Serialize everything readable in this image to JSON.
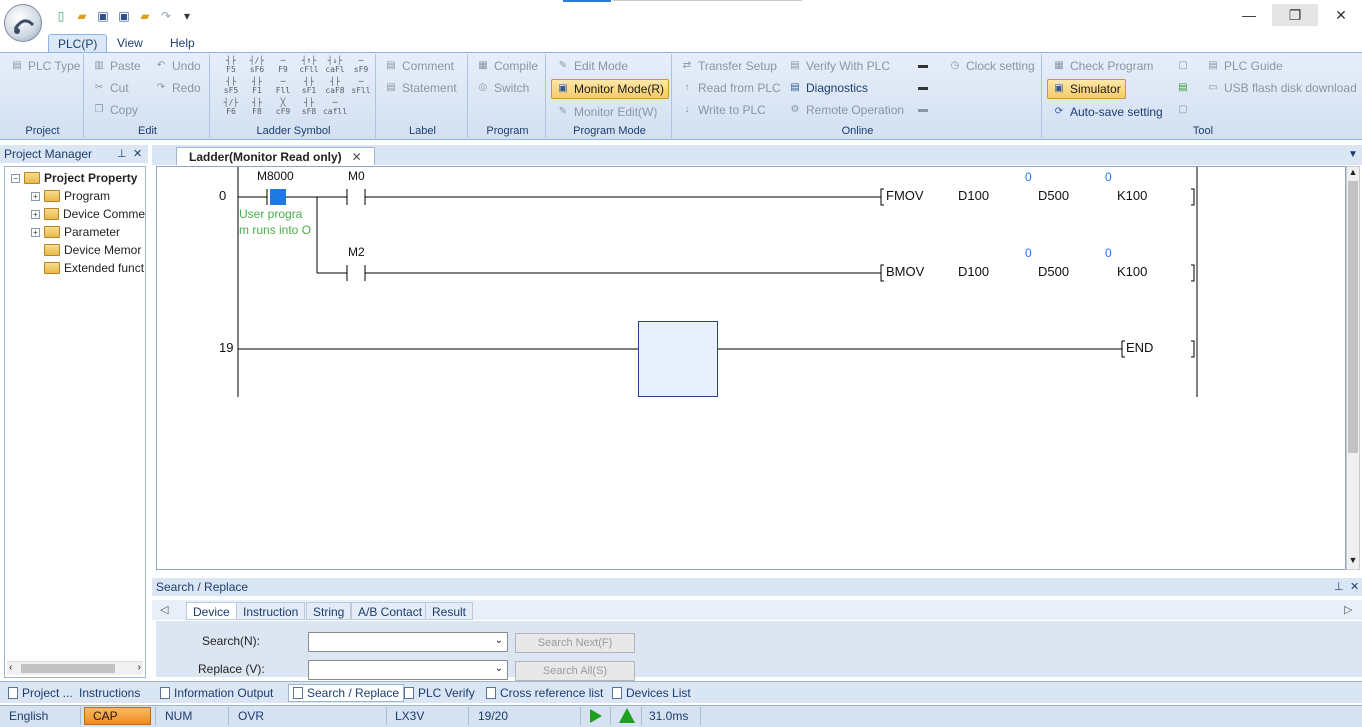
{
  "app": {
    "quick_access_dropdown": "▾"
  },
  "window_controls": {
    "minimize": "—",
    "restore": "❐",
    "close": "✕"
  },
  "ribbon_tabs": [
    "PLC(P)",
    "View",
    "Help"
  ],
  "ribbon": {
    "project": {
      "label": "Project",
      "plc_type": "PLC Type"
    },
    "edit": {
      "label": "Edit",
      "paste": "Paste",
      "cut": "Cut",
      "copy": "Copy",
      "undo": "Undo",
      "redo": "Redo"
    },
    "ladder_symbol": {
      "label": "Ladder Symbol",
      "symbols": [
        [
          "┤├",
          "F5"
        ],
        [
          "┤/├",
          "sF6"
        ],
        [
          "─",
          "F9"
        ],
        [
          "┤↑├",
          "cFll"
        ],
        [
          "┤↓├",
          "caFl"
        ],
        [
          "─",
          "sF9"
        ],
        [
          "┤├",
          "sF5"
        ],
        [
          "┤├",
          "F1"
        ],
        [
          "─",
          "Fll"
        ],
        [
          "┤├",
          "sF1"
        ],
        [
          "┤├",
          "caF8"
        ],
        [
          "─",
          "sFll"
        ],
        [
          "┤/├",
          "F6"
        ],
        [
          "┤├",
          "F8"
        ],
        [
          "╳",
          "cF9"
        ],
        [
          "┤├",
          "sF8"
        ],
        [
          "─",
          "cafll"
        ]
      ]
    },
    "label": {
      "label": "Label",
      "comment": "Comment",
      "statement": "Statement"
    },
    "program": {
      "label": "Program",
      "compile": "Compile",
      "switch": "Switch"
    },
    "program_mode": {
      "label": "Program Mode",
      "edit_mode": "Edit Mode",
      "monitor_mode": "Monitor Mode(R)",
      "monitor_edit": "Monitor Edit(W)"
    },
    "online": {
      "label": "Online",
      "transfer_setup": "Transfer Setup",
      "read_from_plc": "Read from PLC",
      "write_to_plc": "Write to PLC",
      "verify_with_plc": "Verify With PLC",
      "diagnostics": "Diagnostics",
      "remote_operation": "Remote Operation",
      "clock_setting": "Clock setting"
    },
    "tool": {
      "label": "Tool",
      "check_program": "Check Program",
      "simulator": "Simulator",
      "auto_save": "Auto-save setting",
      "plc_guide": "PLC Guide",
      "usb_download": "USB flash disk download"
    }
  },
  "project_manager": {
    "title": "Project Manager",
    "pin": "⊥",
    "close": "✕",
    "tree": [
      "Project Property",
      "Program",
      "Device Comme",
      "Parameter",
      "Device Memor",
      "Extended funct"
    ]
  },
  "doc_tab": {
    "title": "Ladder(Monitor Read only)",
    "close": "✕"
  },
  "ladder": {
    "rung0_step": "0",
    "contact1": "M8000",
    "contact2": "M0",
    "contact3": "M2",
    "comment_line1": "User progra",
    "comment_line2": "m runs into O",
    "fmov": {
      "instr": "FMOV",
      "op1": "D100",
      "op2": "D500",
      "op3": "K100",
      "val1": "0",
      "val2": "0"
    },
    "bmov": {
      "instr": "BMOV",
      "op1": "D100",
      "op2": "D500",
      "op3": "K100",
      "val1": "0",
      "val2": "0"
    },
    "rung19_step": "19",
    "end": "END"
  },
  "search_replace": {
    "title": "Search / Replace",
    "tabs": [
      "Device",
      "Instruction",
      "String",
      "A/B Contact",
      "Result"
    ],
    "search_label": "Search(N):",
    "replace_label": "Replace (V):",
    "search_next": "Search Next(F)",
    "search_all": "Search All(S)"
  },
  "bottom_tabs": [
    "Project ...",
    "Instructions",
    "Information Output",
    "Search / Replace",
    "PLC Verify",
    "Cross reference list",
    "Devices List"
  ],
  "status": {
    "language": "English",
    "cap": "CAP",
    "num": "NUM",
    "ovr": "OVR",
    "plc": "LX3V",
    "step": "19/20",
    "scan": "31.0ms"
  },
  "colors": {
    "ribbon_bg": "#dbe8f7",
    "highlight": "#f7c96a",
    "active_cell": "#1f7ae0",
    "comment": "#4aae4a"
  }
}
